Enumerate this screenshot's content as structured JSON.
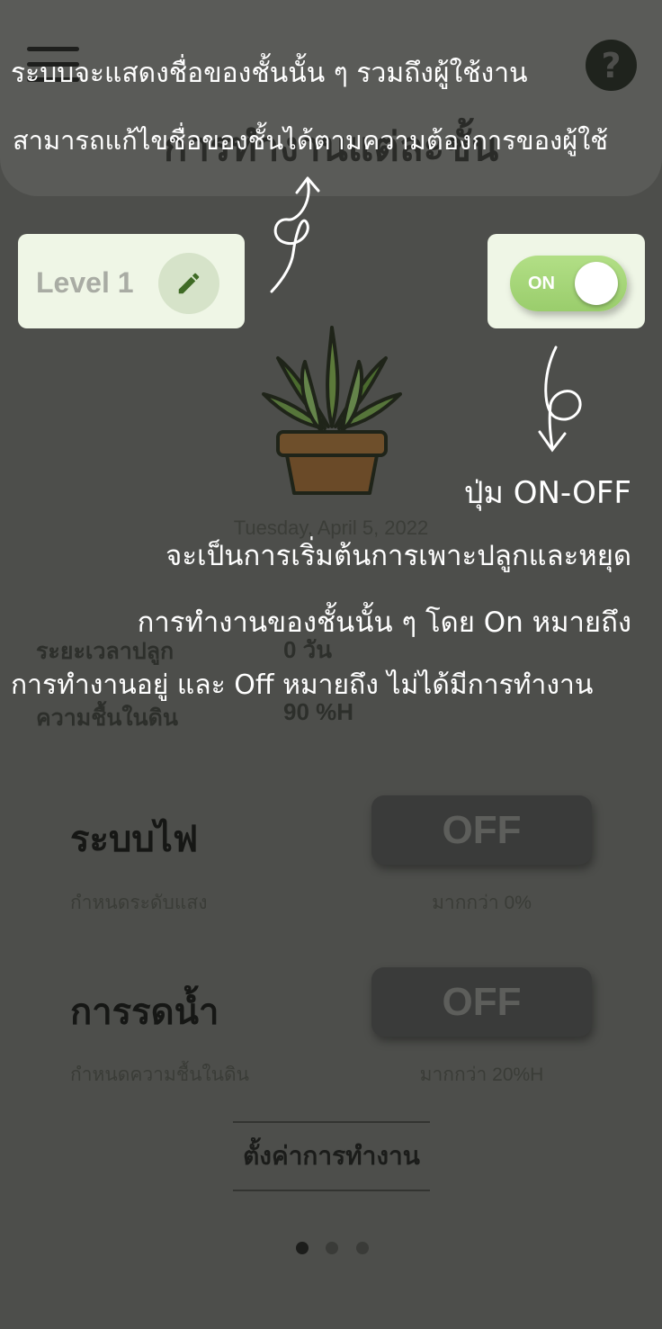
{
  "header": {
    "title": "การทำงานแต่ละชั้น",
    "menu_icon": "hamburger-menu-icon",
    "help_icon": "question-mark-icon",
    "help_label": "?"
  },
  "annotations": {
    "top_line1": "ระบบจะแสดงชื่อของชั้นนั้น ๆ รวมถึงผู้ใช้งาน",
    "top_line2": "สามารถแก้ไขชื่อของชั้นได้ตามความต้องการของผู้ใช้",
    "arrow_number_top": "9",
    "arrow_number_right": "6",
    "toggle_heading": "ปุ่ม ON-OFF",
    "toggle_line1": "จะเป็นการเริ่มต้นการเพาะปลูกและหยุด",
    "toggle_line2": "การทำงานของชั้นนั้น ๆ โดย On หมายถึง",
    "toggle_line3": "การทำงานอยู่ และ Off หมายถึง ไม่ได้มีการทำงาน"
  },
  "level": {
    "name": "Level 1",
    "edit_icon": "pencil-icon"
  },
  "toggle": {
    "label": "ON",
    "state": "on",
    "color": "#a6d67a"
  },
  "date": "Tuesday, April 5, 2022",
  "stats": {
    "grow_label": "ระยะเวลาปลูก",
    "grow_value": "0  วัน",
    "moisture_label": "ความชื้นในดิน",
    "moisture_value": "90  %H"
  },
  "light": {
    "title": "ระบบไฟ",
    "subtitle": "กำหนดระดับแสง",
    "button_label": "OFF",
    "threshold": "มากกว่า 0%"
  },
  "water": {
    "title": "การรดน้ำ",
    "subtitle": "กำหนดความชื้นในดิน",
    "button_label": "OFF",
    "threshold": "มากกว่า 20%H"
  },
  "settings_label": "ตั้งค่าการทำงาน",
  "pagination": {
    "count": 3,
    "active": 0
  },
  "colors": {
    "accent_green": "#a6d67a",
    "card_bg": "#eff6e6",
    "overlay_bg": "#4d4e4b"
  }
}
